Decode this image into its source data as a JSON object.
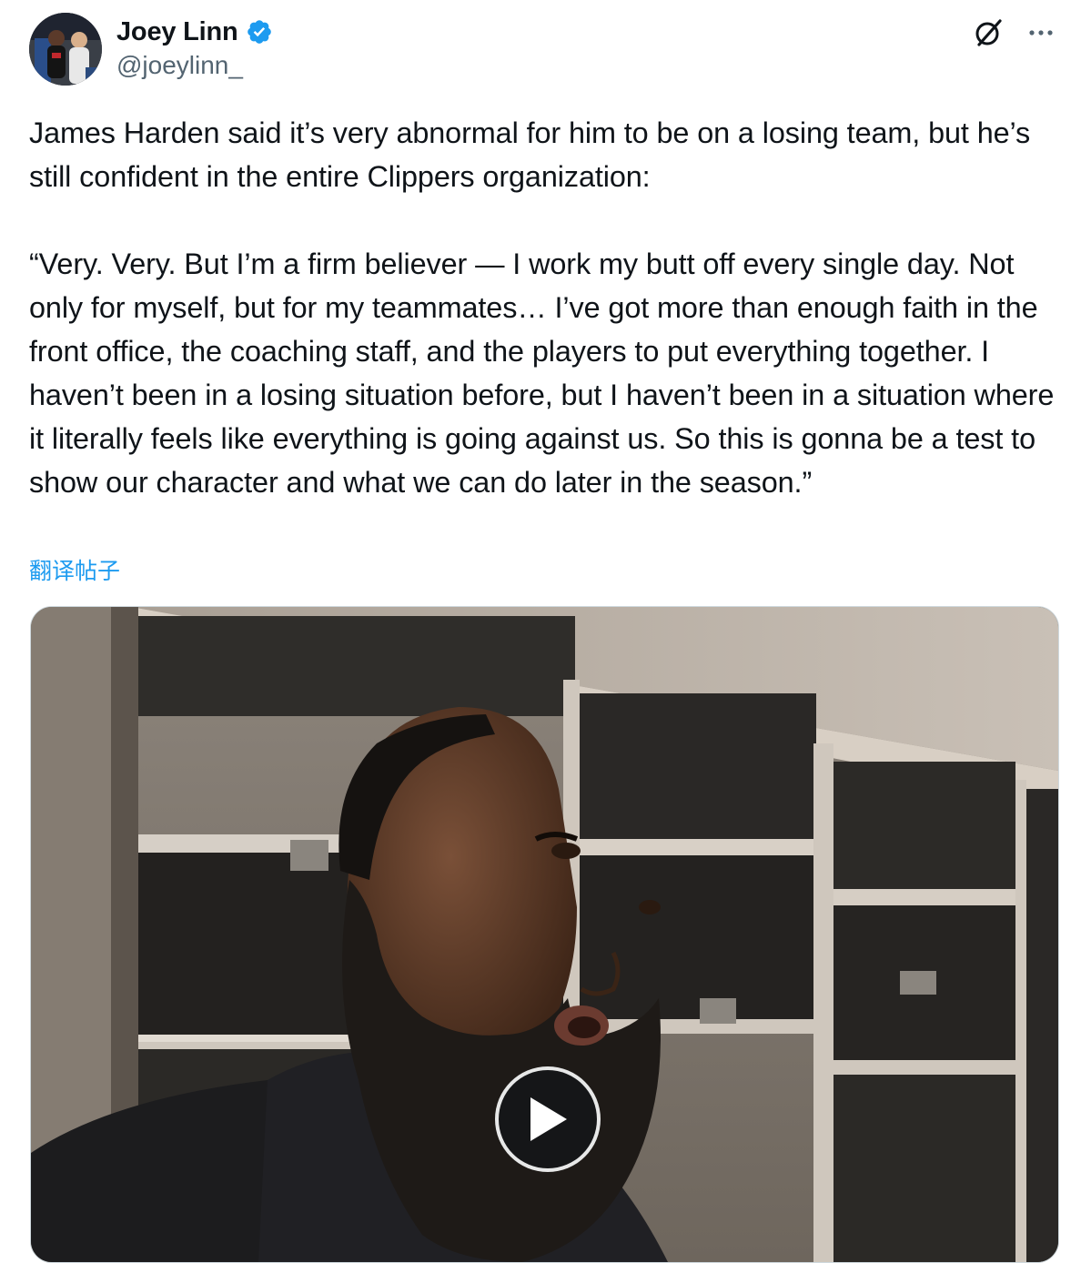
{
  "author": {
    "display_name": "Joey Linn",
    "handle": "@joeylinn_",
    "verified": true,
    "verified_color": "#1d9bf0"
  },
  "actions": {
    "grok_icon": "grok-icon",
    "more_icon": "more-icon"
  },
  "tweet": {
    "text": "James Harden said it’s very abnormal for him to be on a losing team, but he’s still confident in the entire Clippers organization:\n\n“Very. Very. But I’m a firm believer — I work my butt off every single day. Not only for myself, but for my teammates… I’ve got more than enough faith in the front office, the coaching staff, and the players to put everything together. I haven’t been in a losing situation before, but I haven’t been in a situation where it literally feels like everything is going against us. So this is gonna be a test to show our character and what we can do later in the season.”",
    "translate_label": "翻译帖子"
  },
  "media": {
    "type": "video",
    "play_icon": "play-icon"
  }
}
